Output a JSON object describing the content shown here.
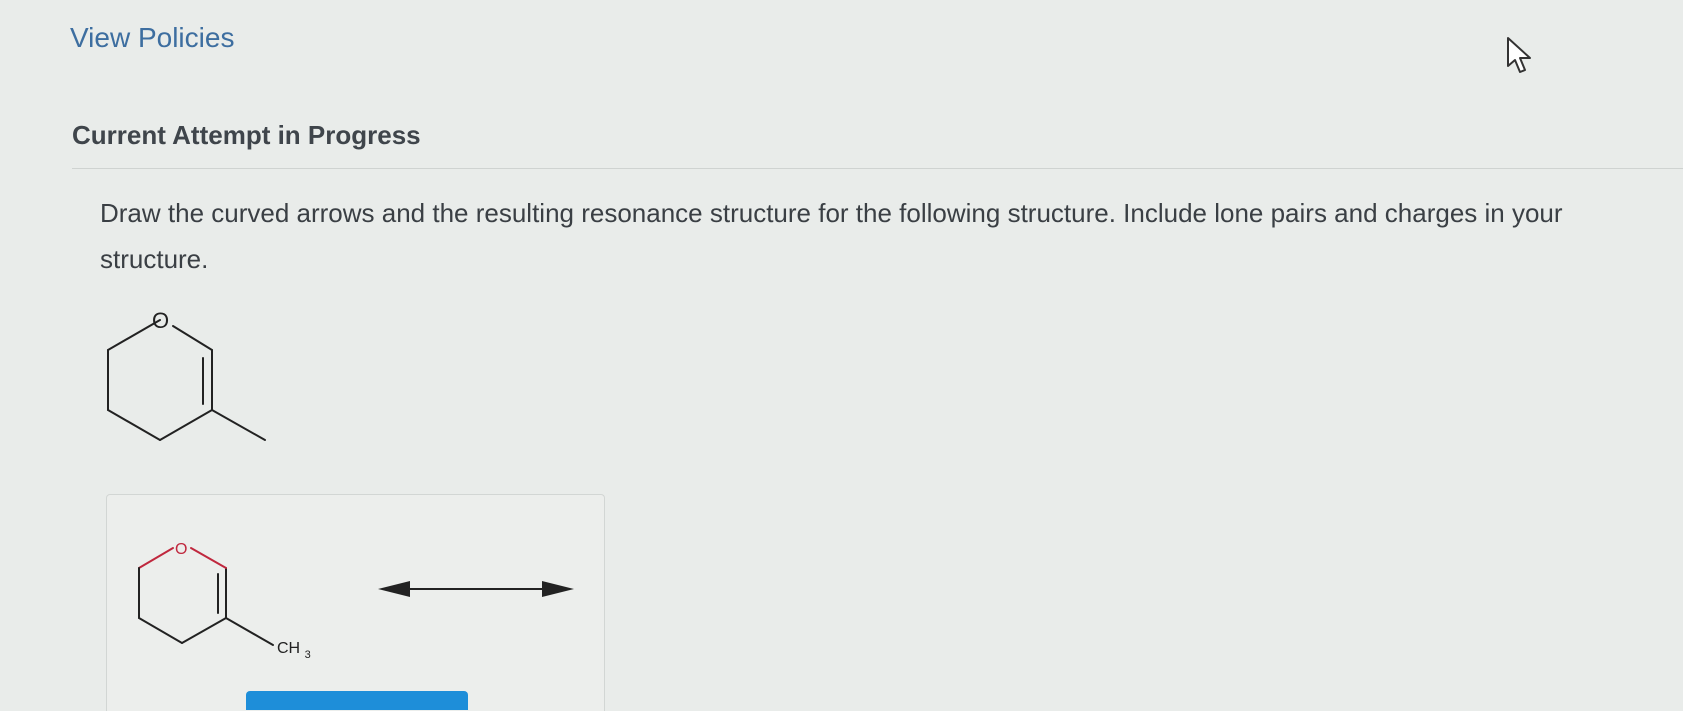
{
  "header": {
    "view_policies_link": "View Policies"
  },
  "attempt": {
    "heading": "Current Attempt in Progress"
  },
  "question": {
    "text": "Draw the curved arrows and the resulting resonance structure for the following structure. Include lone pairs and charges in your structure."
  },
  "given_structure": {
    "oxygen_label": "O"
  },
  "answer_editor": {
    "oxygen_label": "O",
    "methyl_label": "CH",
    "methyl_subscript": "3"
  },
  "icons": {
    "cursor": "mouse-pointer-icon",
    "resonance": "double-headed-arrow-icon"
  },
  "colors": {
    "link": "#3d6ea0",
    "oxygen_bond": "#c0283e",
    "button": "#1e8ed9"
  }
}
